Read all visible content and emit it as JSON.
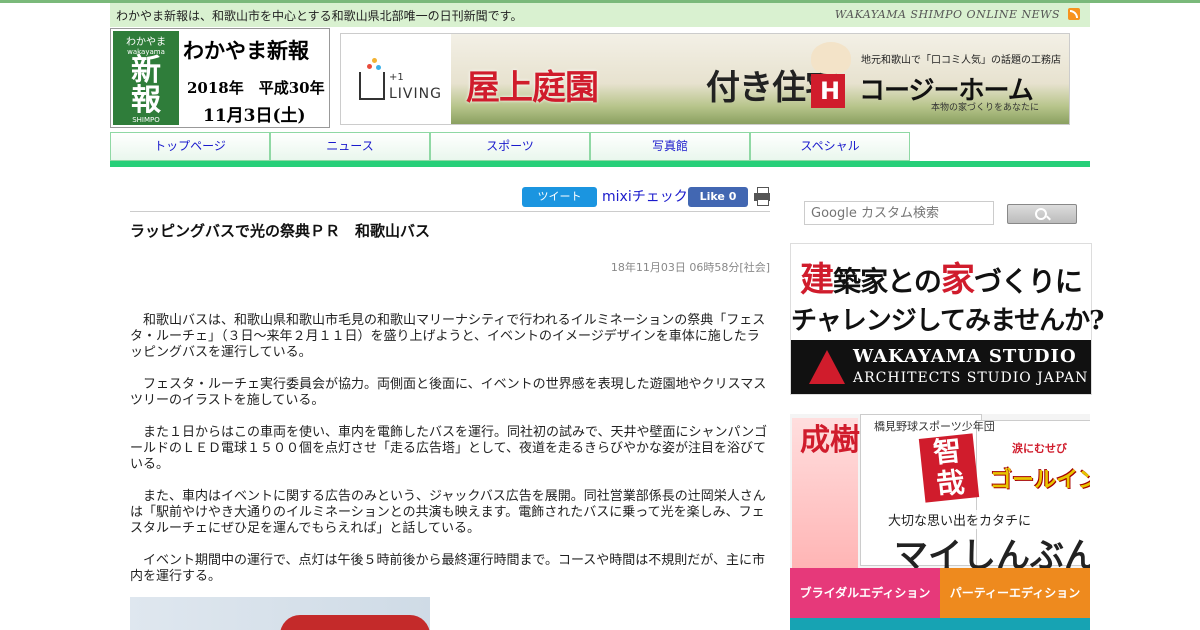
{
  "header": {
    "tagline": "わかやま新報は、和歌山市を中心とする和歌山県北部唯一の日刊新聞です。",
    "online_news": "WAKAYAMA SHIMPO ONLINE NEWS"
  },
  "logo": {
    "mark_top": "わかやま",
    "mark_sub": "wakayama",
    "mark_kanji_1": "新",
    "mark_kanji_2": "報",
    "mark_bottom": "SHIMPO",
    "title": "わかやま新報",
    "date_line_1": "2018年　平成30年",
    "date_line_2": "11月3日(土)"
  },
  "top_banner": {
    "living_small": "+1",
    "living_label": "LIVING",
    "slogan_red": "屋上庭園",
    "slogan_dark": "付き住宅",
    "sub_top": "地元和歌山で「口コミ人気」の話題の工務店",
    "brand": "コージーホーム",
    "sub_bottom": "本物の家づくりをあなたに"
  },
  "nav": {
    "items": [
      "トップページ",
      "ニュース",
      "スポーツ",
      "写真館",
      "スペシャル"
    ]
  },
  "share": {
    "tweet": "ツイート",
    "mixi": "mixiチェック",
    "like": "Like 0"
  },
  "article": {
    "title": "ラッピングバスで光の祭典ＰＲ　和歌山バス",
    "meta": "18年11月03日 06時58分[社会]",
    "paragraphs": [
      "和歌山バスは、和歌山県和歌山市毛見の和歌山マリーナシティで行われるイルミネーションの祭典「フェスタ・ルーチェ」（３日～来年２月１１日）を盛り上げようと、イベントのイメージデザインを車体に施したラッピングバスを運行している。",
      "フェスタ・ルーチェ実行委員会が協力。両側面と後面に、イベントの世界感を表現した遊園地やクリスマスツリーのイラストを施している。",
      "また１日からはこの車両を使い、車内を電飾したバスを運行。同社初の試みで、天井や壁面にシャンパンゴールドのＬＥＤ電球１５００個を点灯させ「走る広告塔」として、夜道を走るきらびやかな姿が注目を浴びている。",
      "また、車内はイベントに関する広告のみという、ジャックバス広告を展開。同社営業部係長の辻岡栄人さんは「駅前やけやき大通りのイルミネーションとの共演も映えます。電飾されたバスに乗って光を楽しみ、フェスタルーチェにぜひ足を運んでもらえれば」と話している。",
      "イベント期間中の運行で、点灯は午後５時前後から最終運行時間まで。コースや時間は不規則だが、主に市内を運行する。"
    ]
  },
  "search": {
    "placeholder": "Google カスタム検索"
  },
  "side_ad_1": {
    "line1_red_a": "建",
    "line1_a": "築家との",
    "line1_red_b": "家",
    "line1_b": "づくりに",
    "line2": "チャレンジしてみませんか?",
    "brand_1": "WAKAYAMA STUDIO",
    "brand_2": "ARCHITECTS STUDIO JAPAN"
  },
  "side_ad_2": {
    "big_red": "成樹",
    "headline": "橋見野球スポーツ少年団",
    "box": "智哉",
    "goal_small": "涙にむせび",
    "goal": "ゴールイン",
    "caption_1": "大切な思い出をカタチに",
    "caption_2": "マイしんぶん",
    "button_1": "ブライダルエディション",
    "button_2": "パーティーエディション"
  },
  "colors": {
    "nav_line": "#27cf79",
    "tagbar": "#d9f1d0",
    "logo_green": "#2f7d3a",
    "banner_red": "#d01c2c"
  }
}
